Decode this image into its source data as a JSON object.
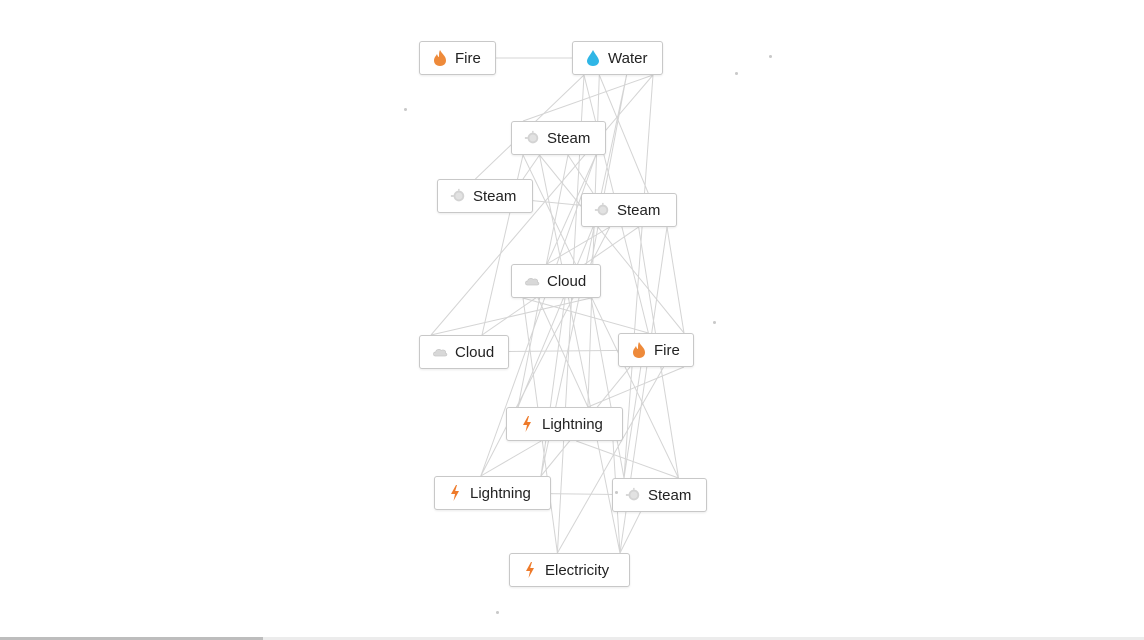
{
  "canvas": {
    "nodes": [
      {
        "id": "fire-1",
        "label": "Fire",
        "icon": "fire-icon"
      },
      {
        "id": "water-1",
        "label": "Water",
        "icon": "water-drop-icon"
      },
      {
        "id": "steam-1",
        "label": "Steam",
        "icon": "steam-icon"
      },
      {
        "id": "steam-2",
        "label": "Steam",
        "icon": "steam-icon"
      },
      {
        "id": "steam-3",
        "label": "Steam",
        "icon": "steam-icon"
      },
      {
        "id": "cloud-1",
        "label": "Cloud",
        "icon": "cloud-icon"
      },
      {
        "id": "cloud-2",
        "label": "Cloud",
        "icon": "cloud-icon"
      },
      {
        "id": "fire-2",
        "label": "Fire",
        "icon": "fire-icon"
      },
      {
        "id": "lightning-1",
        "label": "Lightning",
        "icon": "lightning-icon"
      },
      {
        "id": "lightning-2",
        "label": "Lightning",
        "icon": "lightning-icon"
      },
      {
        "id": "steam-4",
        "label": "Steam",
        "icon": "steam-icon"
      },
      {
        "id": "electricity-1",
        "label": "Electricity",
        "icon": "lightning-icon"
      }
    ]
  },
  "colors": {
    "fire": "#ee8a3a",
    "water": "#2fb6e6",
    "steam": "#c4c4c4",
    "cloud": "#d8d8d8",
    "lightning": "#ee7a2a",
    "edge": "#d4d4d4"
  },
  "progress": {
    "fraction": 0.23
  }
}
